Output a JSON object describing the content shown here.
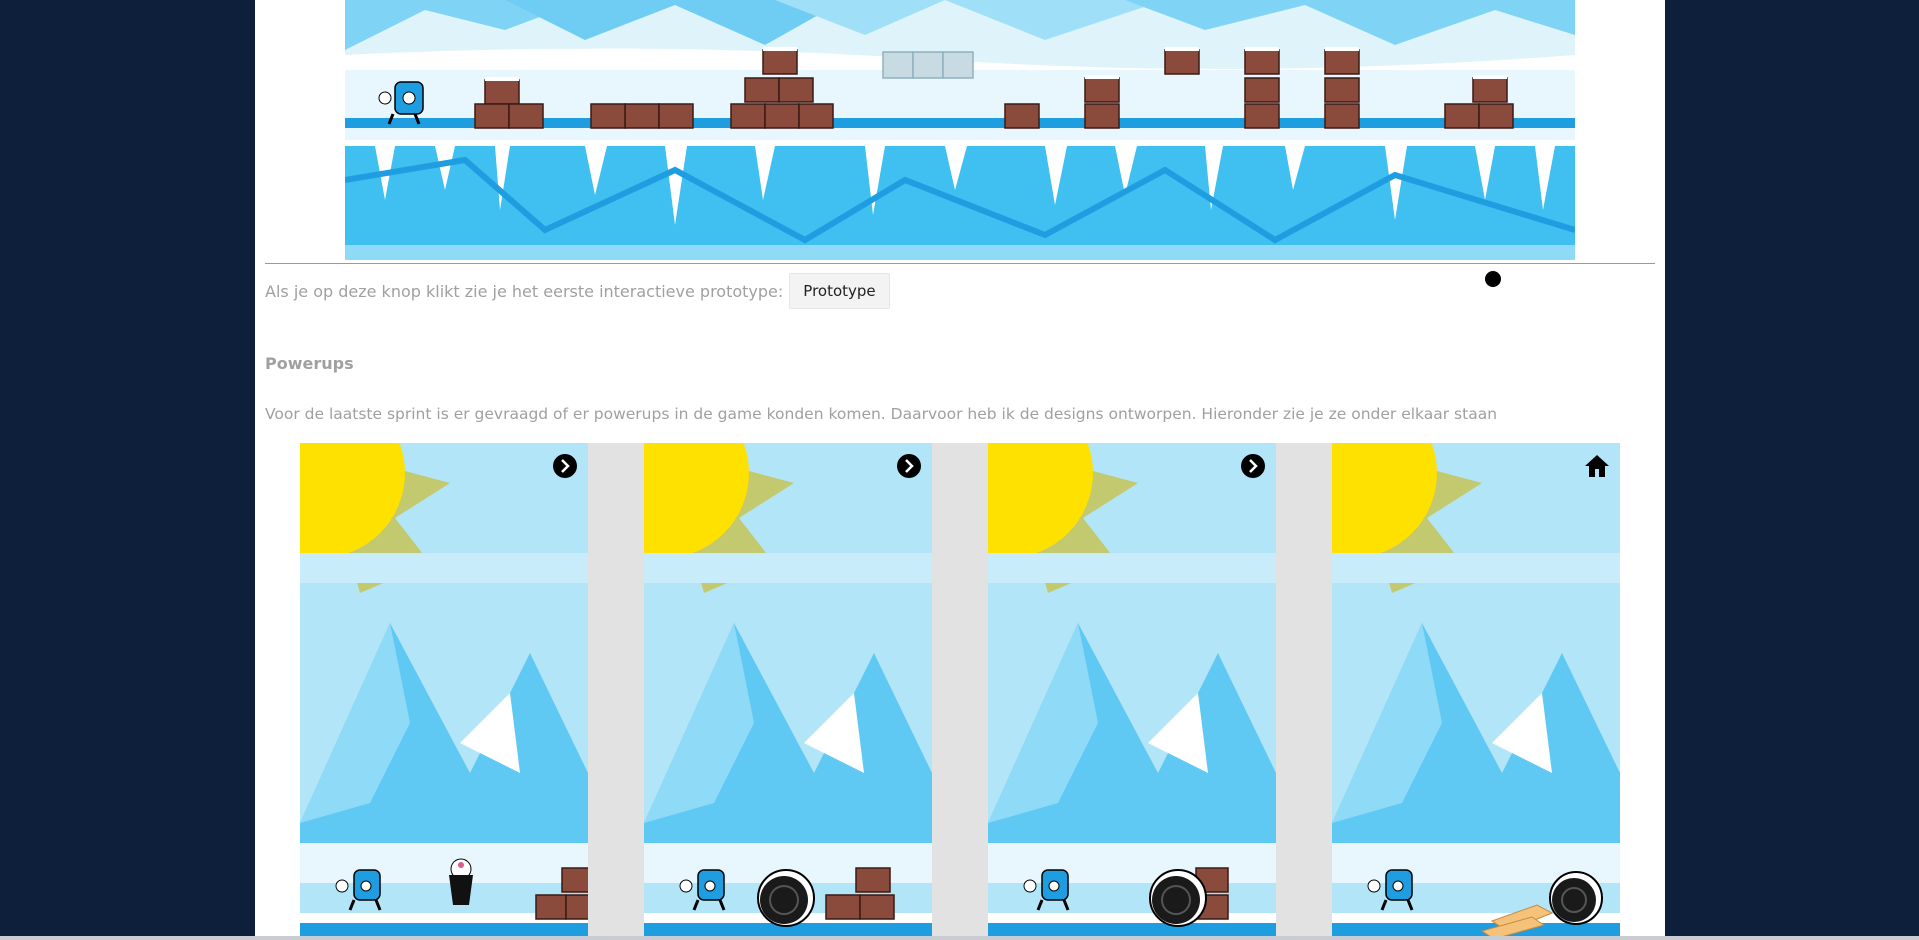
{
  "prototype_row": {
    "text": "Als je op deze knop klikt zie je het eerste interactieve prototype:",
    "button_label": "Prototype"
  },
  "powerups": {
    "title": "Powerups",
    "description": "Voor de laatste sprint is er gevraagd of er powerups in de game konden komen. Daarvoor heb ik de designs ontworpen. Hieronder zie je ze onder elkaar staan"
  },
  "screens": [
    {
      "nav_icon": "chevron-right-icon",
      "item": "milkshake"
    },
    {
      "nav_icon": "chevron-right-icon",
      "item": "cookie"
    },
    {
      "nav_icon": "chevron-right-icon",
      "item": "cookie"
    },
    {
      "nav_icon": "home-icon",
      "item": "wafer-cookie"
    }
  ],
  "colors": {
    "page_background": "#0d1f3a",
    "content_background": "#ffffff",
    "muted_text": "#a0a0a0",
    "sky": "#b3e5f8",
    "ice": "#3fc0f0",
    "sun": "#ffe100",
    "crate": "#8a4a3c"
  }
}
